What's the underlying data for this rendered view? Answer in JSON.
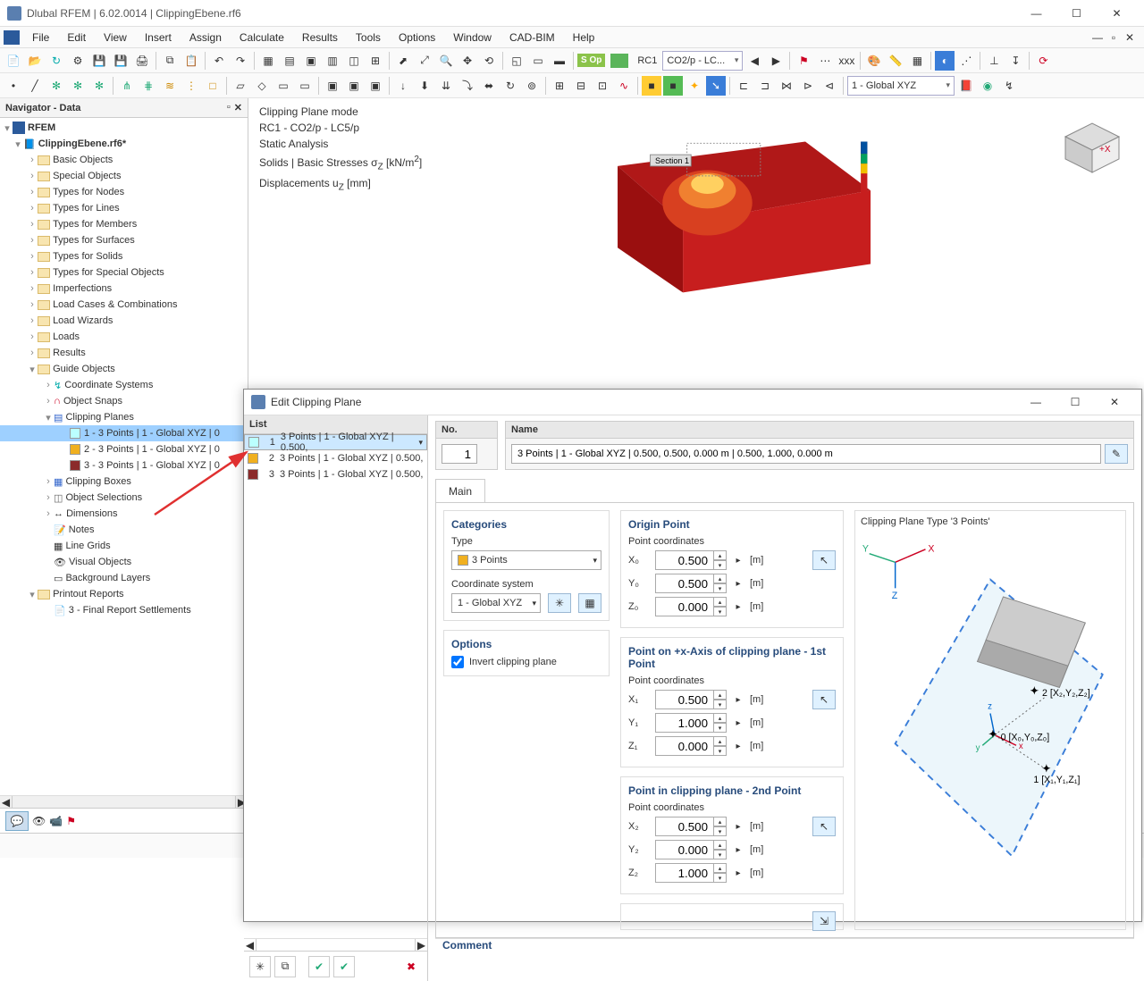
{
  "titlebar": {
    "title": "Dlubal RFEM | 6.02.0014 | ClippingEbene.rf6"
  },
  "menubar": {
    "items": [
      "File",
      "Edit",
      "View",
      "Insert",
      "Assign",
      "Calculate",
      "Results",
      "Tools",
      "Options",
      "Window",
      "CAD-BIM",
      "Help"
    ]
  },
  "toolbar2": {
    "loadcase_badge": "S Op",
    "rc_label": "RC1",
    "lc_combo": "CO2/p - LC...",
    "coord_combo": "1 - Global XYZ"
  },
  "navigator": {
    "title": "Navigator - Data",
    "root": "RFEM",
    "file": "ClippingEbene.rf6*",
    "items": [
      "Basic Objects",
      "Special Objects",
      "Types for Nodes",
      "Types for Lines",
      "Types for Members",
      "Types for Surfaces",
      "Types for Solids",
      "Types for Special Objects",
      "Imperfections",
      "Load Cases & Combinations",
      "Load Wizards",
      "Loads",
      "Results"
    ],
    "guide": "Guide Objects",
    "guide_children": [
      "Coordinate Systems",
      "Object Snaps"
    ],
    "clipping_planes": "Clipping Planes",
    "planes": [
      "1 - 3 Points | 1 - Global XYZ | 0",
      "2 - 3 Points | 1 - Global XYZ | 0",
      "3 - 3 Points | 1 - Global XYZ | 0"
    ],
    "after_planes": [
      "Clipping Boxes",
      "Object Selections",
      "Dimensions",
      "Notes",
      "Line Grids",
      "Visual Objects",
      "Background Layers"
    ],
    "printout": "Printout Reports",
    "report": "3 - Final Report Settlements"
  },
  "viewport": {
    "line1": "Clipping Plane mode",
    "line2": "RC1 - CO2/p - LC5/p",
    "line3": "Static Analysis",
    "line4_a": "Solids | Basic Stresses σ",
    "line4_sub": "Z",
    "line4_b": " [kN/m",
    "line4_sup": "2",
    "line4_c": "]",
    "line5_a": "Displacements u",
    "line5_sub": "Z",
    "line5_b": " [mm]",
    "section_label": "Section 1",
    "axis_x": "+X"
  },
  "dialog": {
    "title": "Edit Clipping Plane",
    "list_header": "List",
    "list": [
      {
        "n": "1",
        "txt": "3 Points | 1 - Global XYZ | 0.500,"
      },
      {
        "n": "2",
        "txt": "3 Points | 1 - Global XYZ | 0.500,"
      },
      {
        "n": "3",
        "txt": "3 Points | 1 - Global XYZ | 0.500,"
      }
    ],
    "no_header": "No.",
    "no_value": "1",
    "name_header": "Name",
    "name_value": "3 Points | 1 - Global XYZ | 0.500, 0.500, 0.000 m | 0.500, 1.000, 0.000 m",
    "tab_main": "Main",
    "categories_h": "Categories",
    "type_label": "Type",
    "type_value": "3 Points",
    "coord_label": "Coordinate system",
    "coord_value": "1 - Global XYZ",
    "options_h": "Options",
    "invert_label": "Invert clipping plane",
    "origin_h": "Origin Point",
    "pt_coord_label": "Point coordinates",
    "first_pt_h": "Point on +x-Axis of clipping plane - 1st Point",
    "second_pt_h": "Point in clipping plane - 2nd Point",
    "coords": {
      "origin": {
        "x": "0.500",
        "y": "0.500",
        "z": "0.000"
      },
      "p1": {
        "x": "0.500",
        "y": "1.000",
        "z": "0.000"
      },
      "p2": {
        "x": "0.500",
        "y": "0.000",
        "z": "1.000"
      }
    },
    "labels": {
      "x0": "X₀",
      "y0": "Y₀",
      "z0": "Z₀",
      "x1": "X₁",
      "y1": "Y₁",
      "z1": "Z₁",
      "x2": "X₂",
      "y2": "Y₂",
      "z2": "Z₂",
      "unit": "[m]"
    },
    "illust_h": "Clipping Plane Type '3 Points'",
    "illust_labels": {
      "p0": "0 [X₀,Y₀,Z₀]",
      "p1": "1 [X₁,Y₁,Z₁]",
      "p2": "2 [X₂,Y₂,Z₂]",
      "ax_x": "X",
      "ax_y": "Y",
      "ax_z": "Z"
    },
    "comment_h": "Comment"
  }
}
